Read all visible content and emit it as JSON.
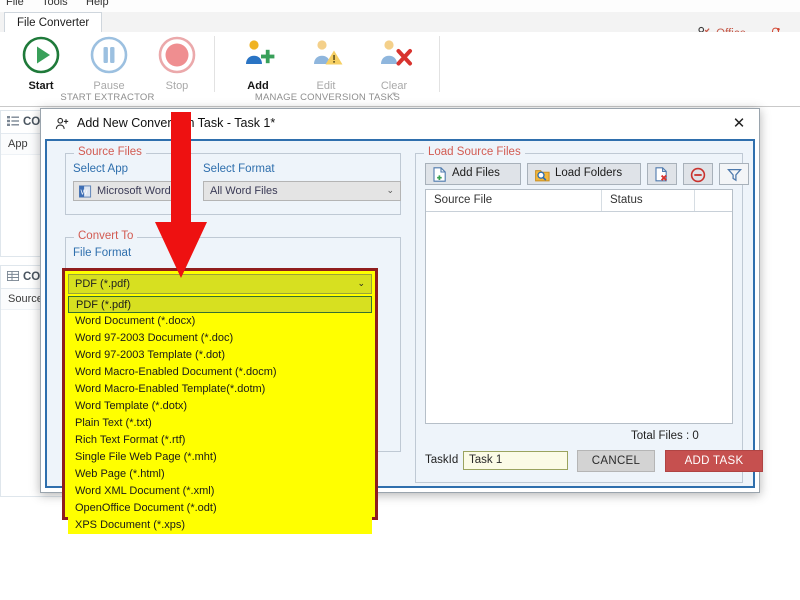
{
  "app": {
    "menu": [
      "File",
      "Tools",
      "Help"
    ],
    "tab": "File Converter",
    "account": {
      "label": "Office",
      "icon": "user-check-icon",
      "caret": "▾",
      "bell_icon": "bell-icon",
      "bell_caret": "▾"
    },
    "ribbon_groups": [
      {
        "title": "START EXTRACTOR",
        "buttons": [
          {
            "label": "Start",
            "icon": "play-circle-icon",
            "enabled": true
          },
          {
            "label": "Pause",
            "icon": "pause-circle-icon",
            "enabled": false
          },
          {
            "label": "Stop",
            "icon": "stop-circle-icon",
            "enabled": false
          }
        ]
      },
      {
        "title": "MANAGE CONVERSION TASKS",
        "buttons": [
          {
            "label": "Add",
            "icon": "user-add-icon",
            "enabled": true
          },
          {
            "label": "Edit",
            "icon": "user-warning-icon",
            "enabled": false
          },
          {
            "label": "Clear",
            "icon": "user-remove-icon",
            "enabled": false,
            "dropdown": "▾"
          }
        ]
      }
    ],
    "background_panels": [
      {
        "title": "CON",
        "icon": "list-icon",
        "column": "App"
      },
      {
        "title": "CON",
        "icon": "table-icon",
        "column": "Source"
      }
    ]
  },
  "dialog": {
    "icon": "add-user-icon",
    "title": "Add New Conversion Task - Task 1*",
    "close_icon": "close-icon",
    "source_files": {
      "legend": "Source Files",
      "select_app_label": "Select App",
      "select_app_value": "Microsoft Word",
      "select_app_icon": "word-icon",
      "select_format_label": "Select Format",
      "select_format_value": "All Word Files",
      "caret": "⌄"
    },
    "convert_to": {
      "legend": "Convert To",
      "file_format_label": "File Format",
      "selected": "PDF (*.pdf)",
      "caret": "⌄",
      "options": [
        "PDF (*.pdf)",
        "Word Document (*.docx)",
        "Word 97-2003 Document (*.doc)",
        "Word 97-2003 Template (*.dot)",
        "Word Macro-Enabled Document (*.docm)",
        "Word Macro-Enabled Template(*.dotm)",
        "Word Template (*.dotx)",
        "Plain Text (*.txt)",
        "Rich Text Format (*.rtf)",
        "Single File Web Page (*.mht)",
        "Web Page (*.html)",
        "Word XML Document (*.xml)",
        "OpenOffice Document (*.odt)",
        "XPS Document (*.xps)"
      ],
      "selected_index": 0
    },
    "load_source_files": {
      "legend": "Load Source Files",
      "toolbar": [
        {
          "label": "Add Files",
          "icon": "file-add-icon"
        },
        {
          "label": "Load Folders",
          "icon": "folder-search-icon"
        },
        {
          "label": "",
          "icon": "file-remove-icon"
        },
        {
          "label": "",
          "icon": "remove-all-icon"
        },
        {
          "label": "",
          "icon": "filter-icon"
        }
      ],
      "columns": [
        "Source File",
        "Status"
      ],
      "rows": [],
      "total_files": "Total Files : 0"
    },
    "footer": {
      "taskid_label": "TaskId",
      "taskid_value": "Task 1",
      "cancel_label": "CANCEL",
      "add_label": "ADD TASK"
    }
  },
  "annotation": {
    "arrow_icon": "red-down-arrow",
    "color": "#ee1111"
  },
  "colors": {
    "accent_blue": "#2f6fad",
    "legend_red": "#d25b52",
    "highlight_yellow": "#ffff00",
    "highlight_border": "#8f1d1d",
    "add_task_red": "#c6504f",
    "arrow_red": "#ee1111"
  }
}
